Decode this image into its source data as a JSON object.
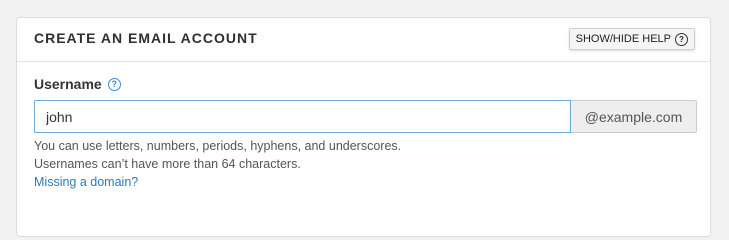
{
  "panel": {
    "title": "CREATE AN EMAIL ACCOUNT",
    "help_toggle_label": "SHOW/HIDE HELP"
  },
  "username": {
    "label": "Username",
    "value": "john",
    "domain_suffix": "@example.com",
    "help_line_1": "You can use letters, numbers, periods, hyphens, and underscores.",
    "help_line_2": "Usernames can’t have more than 64 characters.",
    "missing_domain_link": "Missing a domain?"
  },
  "colors": {
    "link": "#2f7ab8",
    "input_focus_border": "#6aa9d8",
    "info_icon": "#3d8ad3"
  },
  "icons": {
    "help_toggle_icon": "question-circle-icon",
    "label_info_icon": "info-question-icon"
  }
}
